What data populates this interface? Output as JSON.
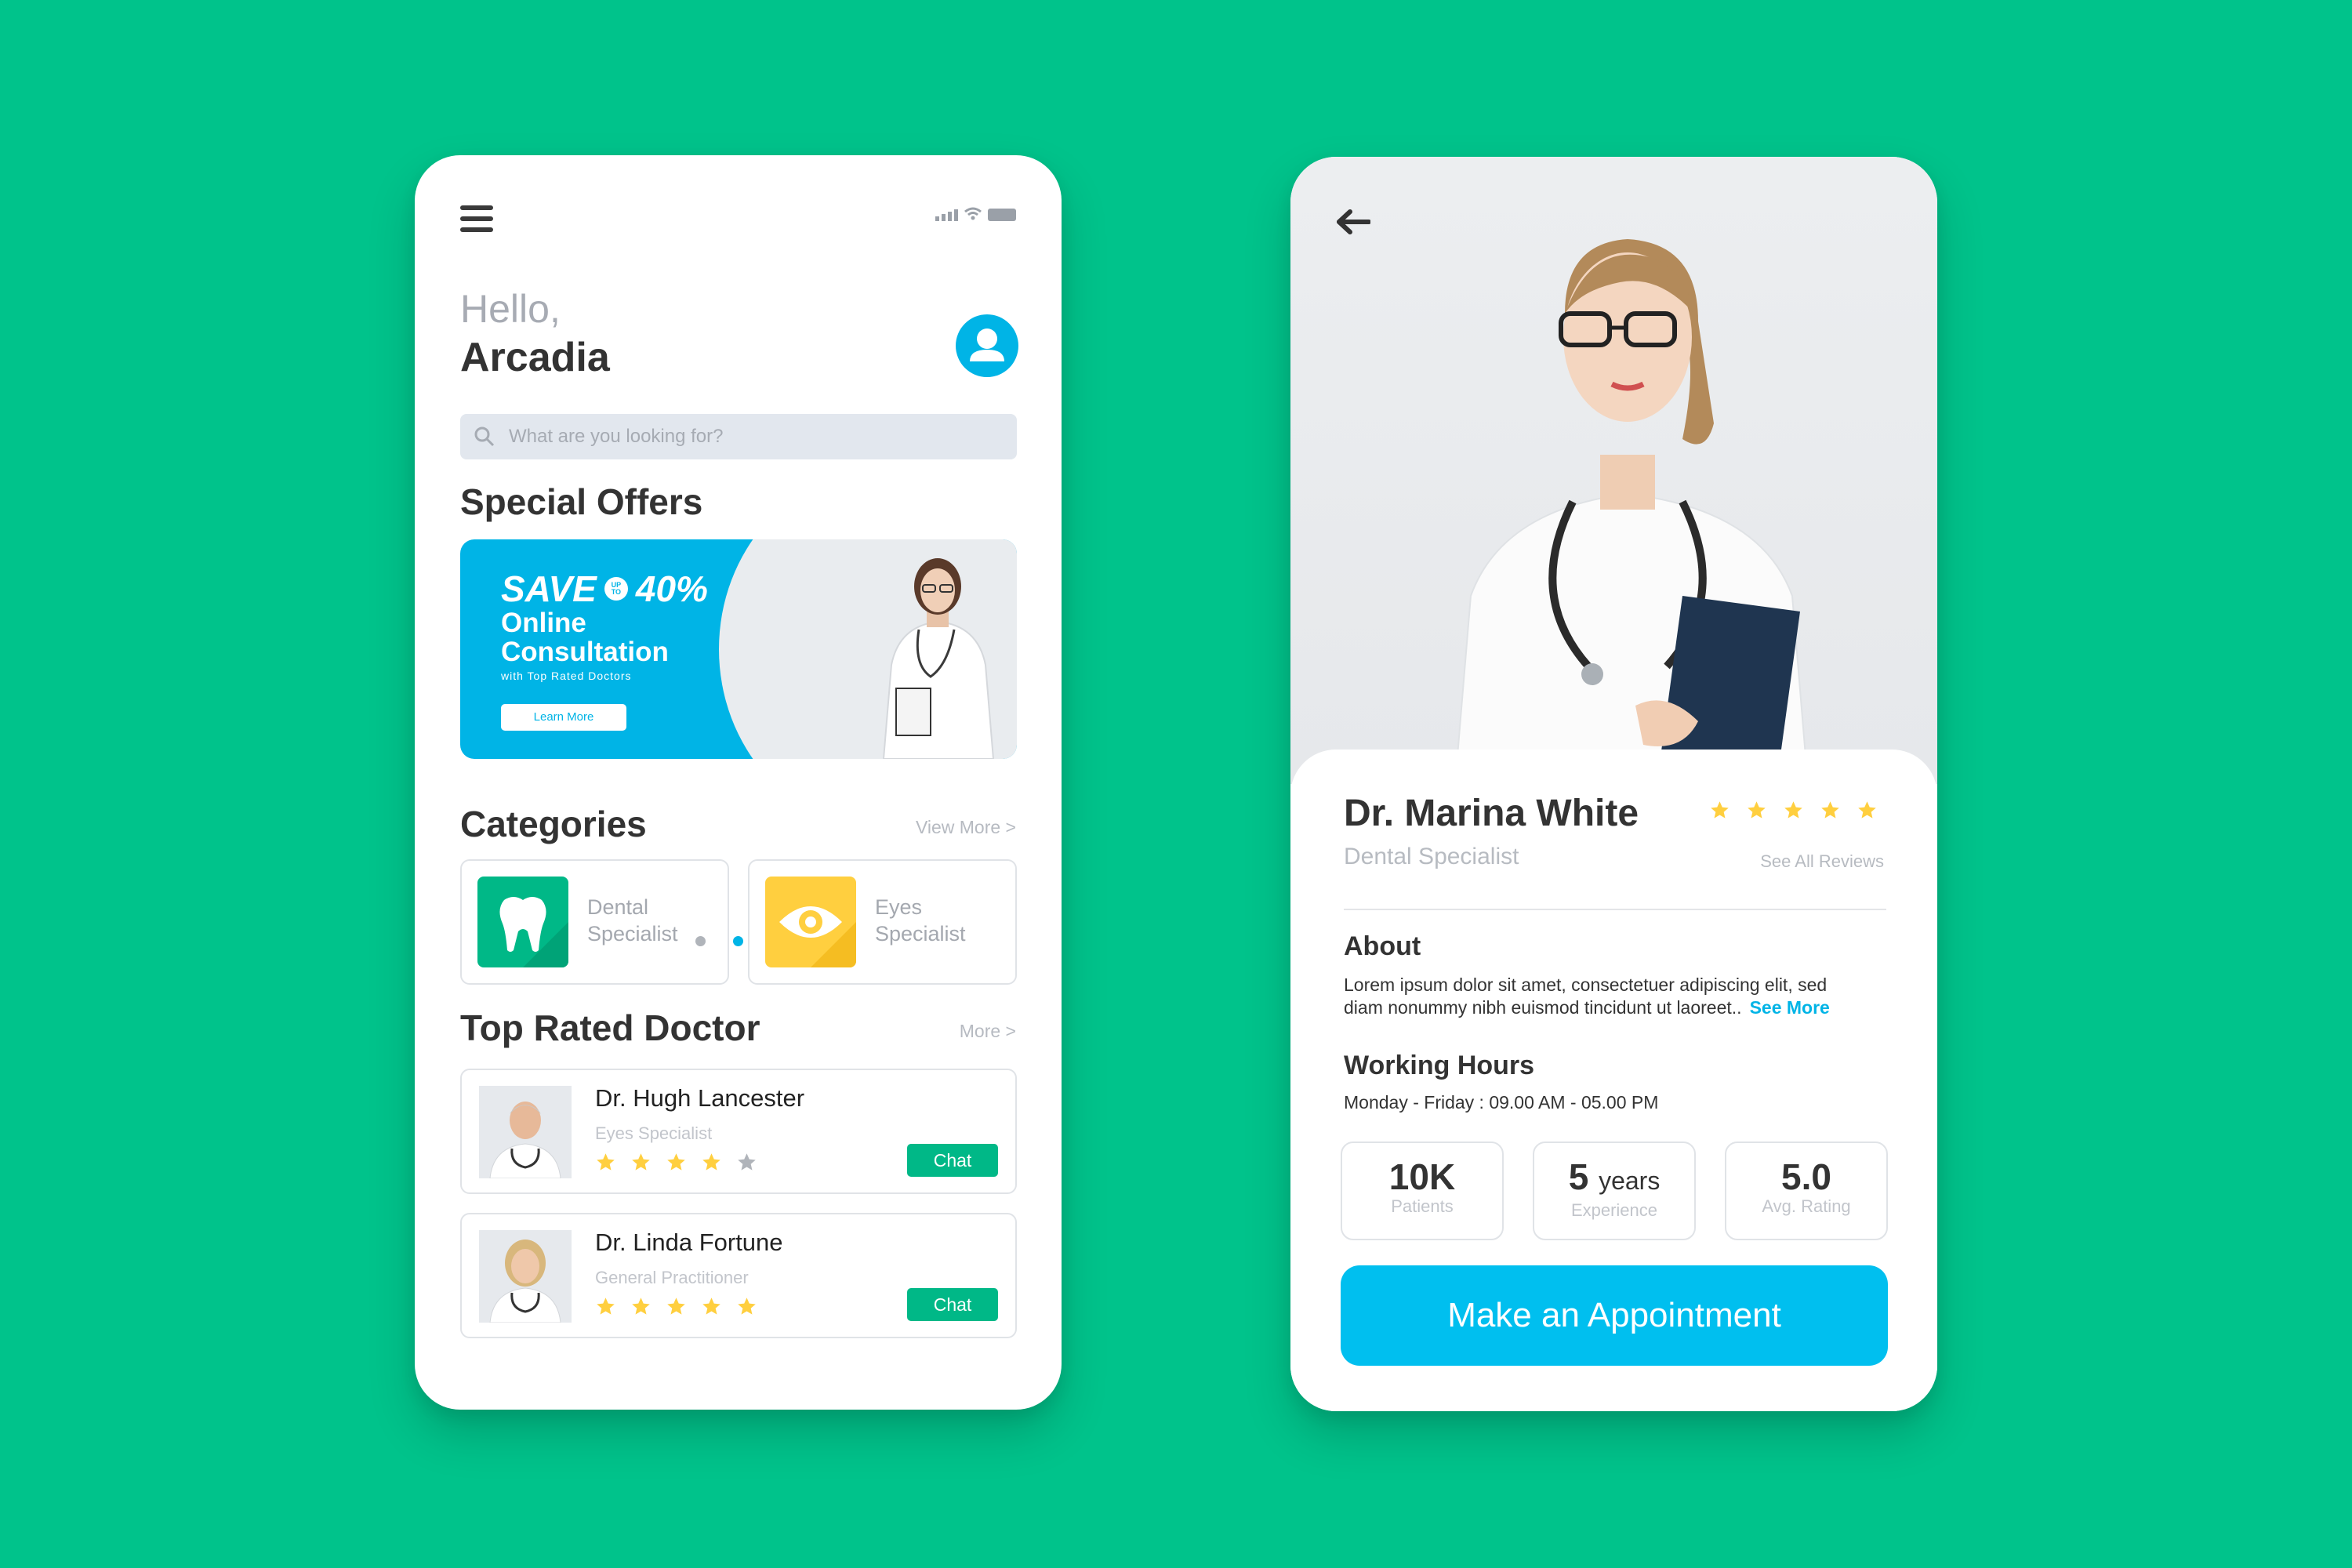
{
  "left": {
    "greeting": {
      "hello": "Hello,",
      "name": "Arcadia"
    },
    "search": {
      "placeholder": "What are you looking for?"
    },
    "special_offers": {
      "title": "Special Offers",
      "banner": {
        "save": "SAVE",
        "upto_top": "UP",
        "upto_bottom": "TO",
        "percent": "40%",
        "line1": "Online",
        "line2": "Consultation",
        "sub": "with Top Rated Doctors",
        "button": "Learn More"
      },
      "active_slide": 2,
      "slides": 3
    },
    "categories": {
      "title": "Categories",
      "link": "View More >",
      "items": [
        {
          "line1": "Dental",
          "line2": "Specialist",
          "icon": "tooth-icon",
          "color": "#00b887"
        },
        {
          "line1": "Eyes",
          "line2": "Specialist",
          "icon": "eye-icon",
          "color": "#ffcf3f"
        }
      ]
    },
    "top_rated": {
      "title": "Top Rated Doctor",
      "link": "More >",
      "doctors": [
        {
          "name": "Dr. Hugh Lancester",
          "specialty": "Eyes Specialist",
          "rating": 4,
          "chat": "Chat"
        },
        {
          "name": "Dr. Linda Fortune",
          "specialty": "General Practitioner",
          "rating": 5,
          "chat": "Chat"
        }
      ]
    }
  },
  "right": {
    "doctor": {
      "name": "Dr. Marina White",
      "specialty": "Dental Specialist",
      "rating": 5,
      "reviews_link": "See All Reviews"
    },
    "about": {
      "title": "About",
      "line1": "Lorem ipsum dolor sit amet, consectetuer adipiscing elit, sed",
      "line2": "diam nonummy nibh euismod tincidunt ut laoreet..",
      "see_more": "See More"
    },
    "hours": {
      "title": "Working Hours",
      "text": "Monday - Friday : 09.00 AM - 05.00 PM"
    },
    "stats": [
      {
        "value": "10K",
        "unit": "",
        "label": "Patients"
      },
      {
        "value": "5",
        "unit": "years",
        "label": "Experience"
      },
      {
        "value": "5.0",
        "unit": "",
        "label": "Avg. Rating"
      }
    ],
    "cta": "Make an Appointment"
  },
  "colors": {
    "background": "#00c38b",
    "accent_blue": "#00b4e6",
    "accent_green": "#00b887",
    "star": "#ffcf3f",
    "star_empty": "#b0b4ba"
  }
}
